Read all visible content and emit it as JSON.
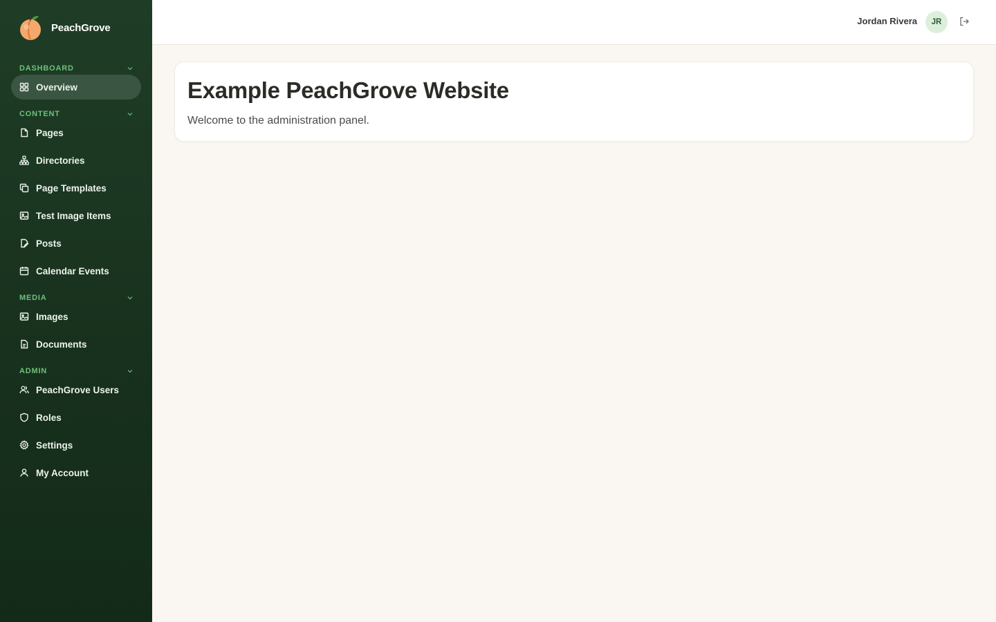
{
  "app": {
    "brand_name": "PeachGrove"
  },
  "sidebar": {
    "sections": [
      {
        "label": "DASHBOARD",
        "items": [
          {
            "label": "Overview",
            "icon": "grid-icon",
            "active": true
          }
        ]
      },
      {
        "label": "CONTENT",
        "items": [
          {
            "label": "Pages",
            "icon": "file-icon"
          },
          {
            "label": "Directories",
            "icon": "sitemap-icon"
          },
          {
            "label": "Page Templates",
            "icon": "copy-icon"
          },
          {
            "label": "Test Image Items",
            "icon": "image-icon"
          },
          {
            "label": "Posts",
            "icon": "file-edit-icon"
          },
          {
            "label": "Calendar Events",
            "icon": "calendar-icon"
          }
        ]
      },
      {
        "label": "MEDIA",
        "items": [
          {
            "label": "Images",
            "icon": "image-icon"
          },
          {
            "label": "Documents",
            "icon": "file-text-icon"
          }
        ]
      },
      {
        "label": "ADMIN",
        "items": [
          {
            "label": "PeachGrove Users",
            "icon": "users-icon"
          },
          {
            "label": "Roles",
            "icon": "shield-icon"
          },
          {
            "label": "Settings",
            "icon": "gear-icon"
          },
          {
            "label": "My Account",
            "icon": "user-icon"
          }
        ]
      }
    ]
  },
  "header": {
    "user_name": "Jordan Rivera",
    "avatar_initials": "JR"
  },
  "main": {
    "title": "Example PeachGrove Website",
    "subtitle": "Welcome to the administration panel."
  },
  "colors": {
    "sidebar_bg": "#1f3d26",
    "section_label": "#6cc27a",
    "active_item_bg": "#3b5543",
    "page_bg": "#faf7f2",
    "avatar_bg": "#dcefdc"
  }
}
